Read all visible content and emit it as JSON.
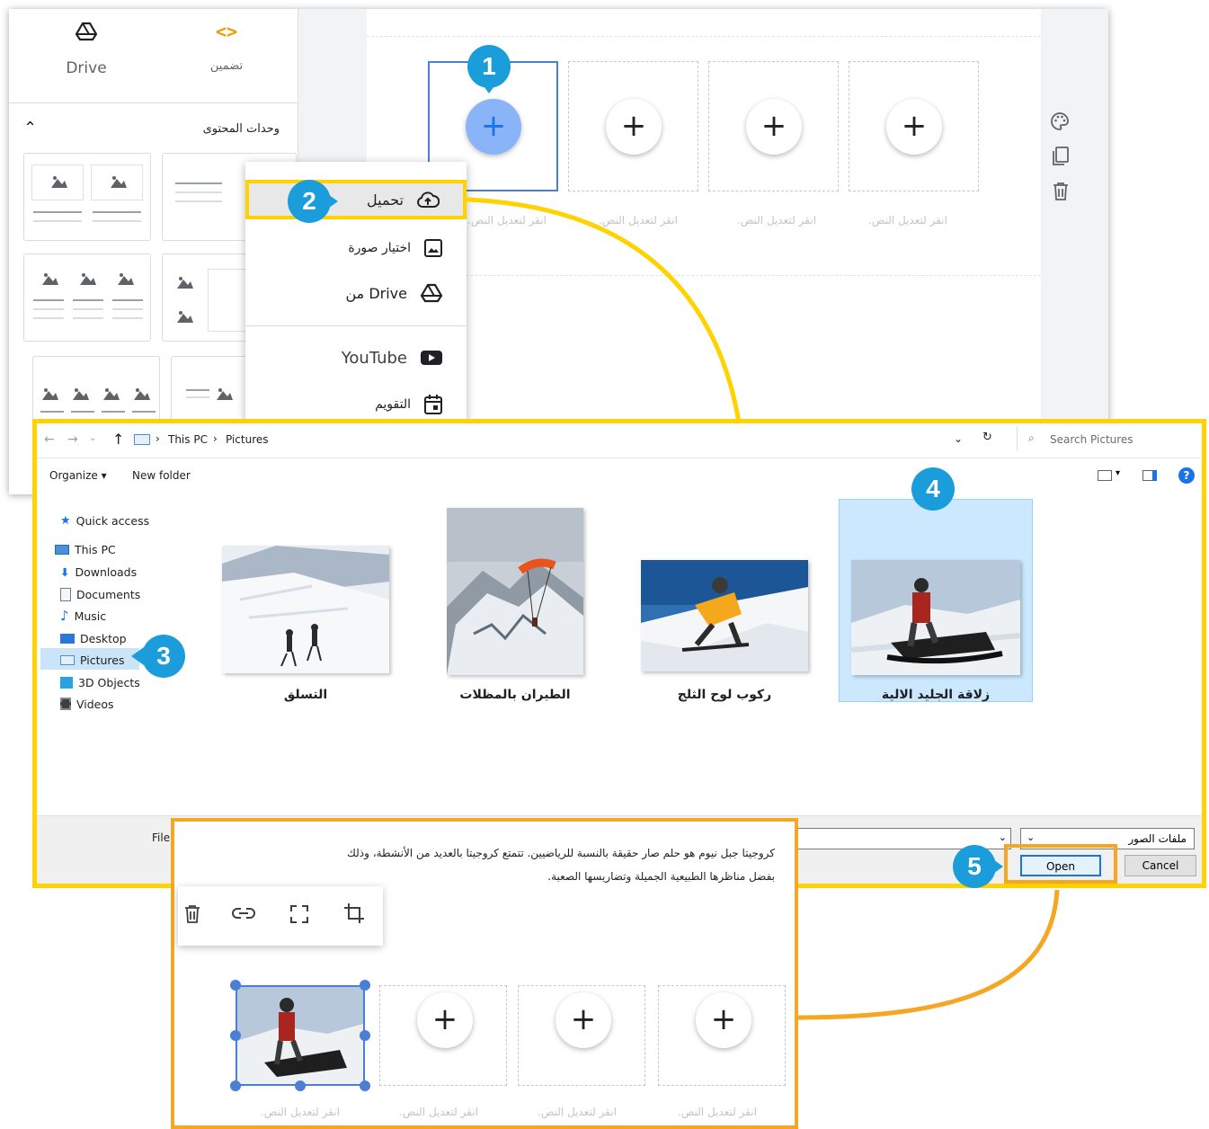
{
  "sites_panel": {
    "tools": [
      {
        "label": "Drive",
        "icon": "drive-icon"
      },
      {
        "label": "تضمين",
        "icon": "embed-code-icon"
      }
    ],
    "content_blocks_label": "وحدات المحتوى",
    "caption_placeholder": "انقر لتعديل النص.",
    "right_tools": [
      "palette-icon",
      "duplicate-icon",
      "delete-icon"
    ]
  },
  "insert_menu": {
    "items": [
      {
        "label": "تحميل",
        "icon": "cloud-upload-icon"
      },
      {
        "label": "اختيار صورة",
        "icon": "image-icon"
      },
      {
        "label": "من Drive",
        "icon": "drive-icon"
      },
      {
        "label": "YouTube",
        "icon": "youtube-icon"
      },
      {
        "label": "التقويم",
        "icon": "calendar-icon"
      }
    ]
  },
  "file_dialog": {
    "breadcrumb": [
      "This PC",
      "Pictures"
    ],
    "search_placeholder": "Search Pictures",
    "toolbar": {
      "organize": "Organize ▾",
      "new_folder": "New folder"
    },
    "nav": [
      {
        "label": "Quick access",
        "icon": "star-icon"
      },
      {
        "label": "This PC",
        "icon": "computer-icon"
      },
      {
        "label": "Downloads",
        "icon": "download-arrow-icon"
      },
      {
        "label": "Documents",
        "icon": "document-icon"
      },
      {
        "label": "Music",
        "icon": "music-note-icon"
      },
      {
        "label": "Desktop",
        "icon": "desktop-icon"
      },
      {
        "label": "Pictures",
        "icon": "pictures-icon"
      },
      {
        "label": "3D Objects",
        "icon": "cube-icon"
      },
      {
        "label": "Videos",
        "icon": "film-icon"
      }
    ],
    "files": [
      {
        "label": "التسلق"
      },
      {
        "label": "الطيران بالمظلات"
      },
      {
        "label": "ركوب لوح الثلج"
      },
      {
        "label": "زلاقة الجليد الالية"
      }
    ],
    "filename_label": "File",
    "filetype_value": "ملفات الصور",
    "open_label": "Open",
    "cancel_label": "Cancel"
  },
  "result_panel": {
    "paragraph_line1": "كروجيتا جبل نيوم هو حلم صار حقيقة بالنسبة للرياضيين. تتمتع كروجيتا بالعديد من الأنشطة، وذلك",
    "paragraph_line2": "بفضل مناظرها الطبيعية الجميلة وتضاريسها الصعبة.",
    "image_toolbar": [
      "delete-icon",
      "link-icon",
      "fullscreen-icon",
      "crop-icon"
    ],
    "caption_placeholder": "انقر لتعديل النص."
  },
  "badges": [
    "1",
    "2",
    "3",
    "4",
    "5"
  ],
  "colors": {
    "highlight_yellow": "#ffd200",
    "highlight_orange": "#f5a623",
    "badge_blue": "#1b9ddb",
    "google_blue": "#4a7fd4"
  }
}
